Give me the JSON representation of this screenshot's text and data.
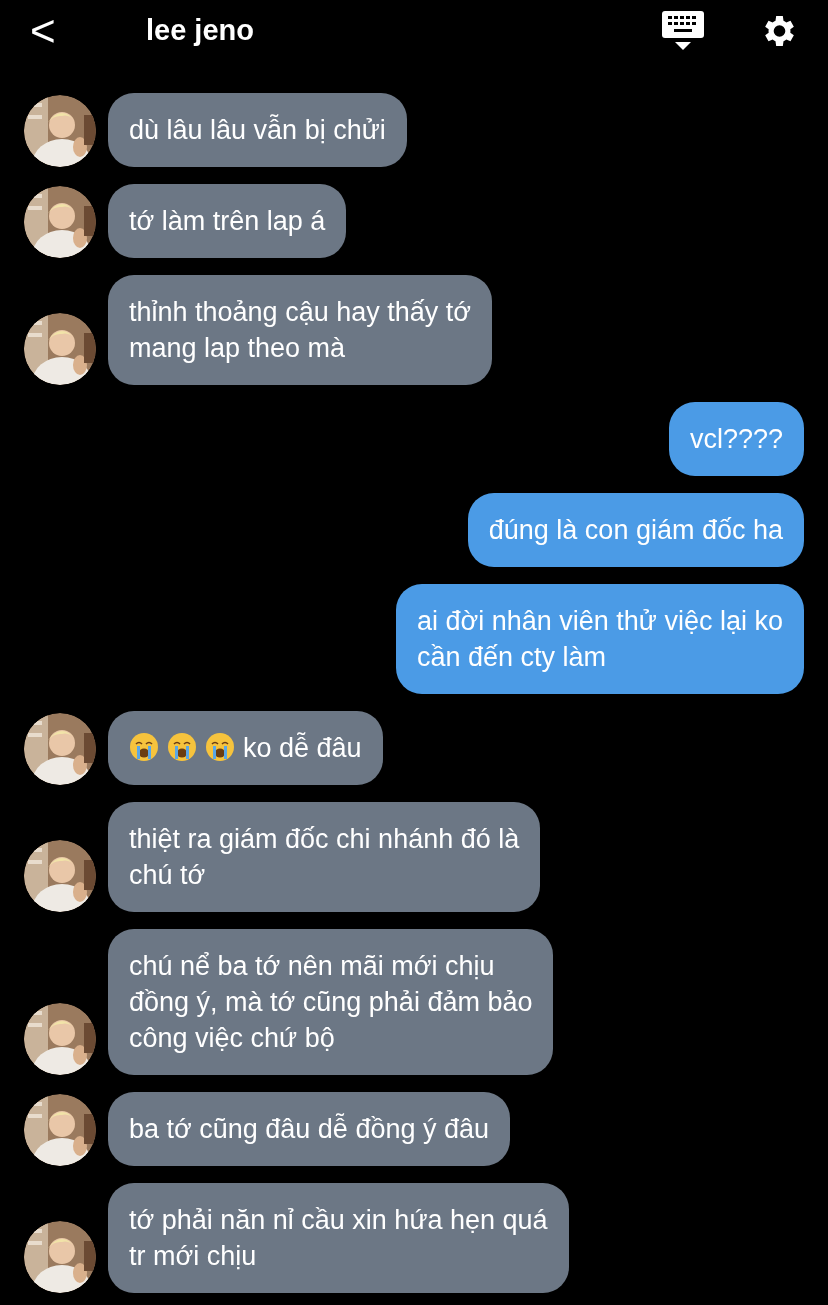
{
  "header": {
    "back": "<",
    "title": "lee jeno"
  },
  "messages": [
    {
      "kind": "received",
      "text": "dù lâu lâu vẫn bị chửi"
    },
    {
      "kind": "received",
      "text": "tớ làm trên lap á"
    },
    {
      "kind": "received",
      "text": "thỉnh thoảng cậu hay thấy tớ\nmang lap theo mà"
    },
    {
      "kind": "sent",
      "text": "vcl????"
    },
    {
      "kind": "sent",
      "text": "đúng là con giám đốc ha"
    },
    {
      "kind": "sent",
      "text": "ai đời nhân viên thử việc lại ko\ncần đến cty làm"
    },
    {
      "kind": "received",
      "text": "ko dễ đâu",
      "emoji_prefix": true
    },
    {
      "kind": "received",
      "text": "thiệt ra giám đốc chi nhánh đó là\nchú tớ"
    },
    {
      "kind": "received",
      "text": "chú nể ba tớ nên mãi mới chịu\nđồng ý, mà tớ cũng phải đảm bảo\ncông việc chứ bộ"
    },
    {
      "kind": "received",
      "text": "ba tớ cũng đâu dễ đồng ý đâu"
    },
    {
      "kind": "received",
      "text": "tớ phải năn nỉ cầu xin hứa hẹn quá\ntr mới chịu"
    }
  ]
}
